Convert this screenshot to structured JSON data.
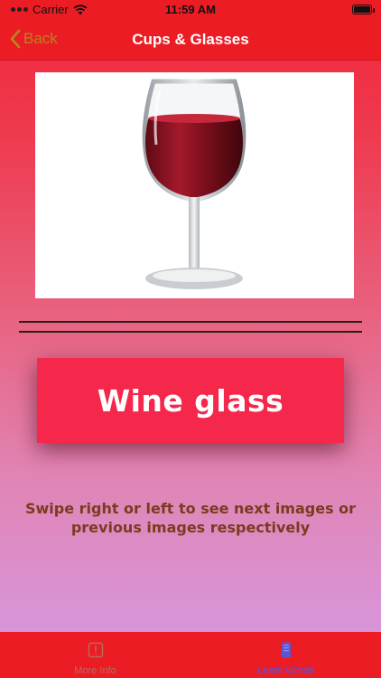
{
  "status_bar": {
    "carrier": "Carrier",
    "time": "11:59 AM"
  },
  "nav": {
    "back_label": "Back",
    "title": "Cups & Glasses"
  },
  "card": {
    "image_subject": "wine-glass-image",
    "word": "Wine glass"
  },
  "hint": "Swipe right  or left to see next images or previous images respectively",
  "tabs": [
    {
      "label": "More Info",
      "icon": "info-icon",
      "selected": false
    },
    {
      "label": "Learn Words",
      "icon": "learn-icon",
      "selected": true
    }
  ],
  "colors": {
    "bar": "#ec1c24",
    "word_button": "#f5284c",
    "hint_text": "#7a3b1e",
    "back_text": "#b3871d",
    "selected_tab": "#5a56d6"
  }
}
